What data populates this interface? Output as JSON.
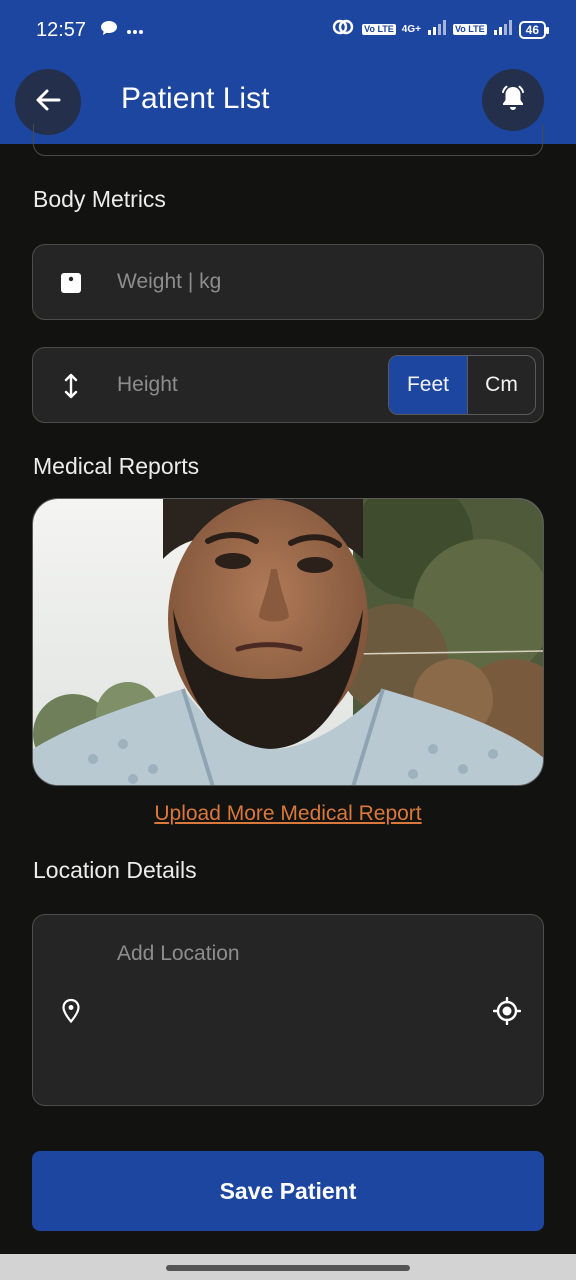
{
  "status_bar": {
    "time": "12:57",
    "network": "4G+",
    "volte": "Vo LTE",
    "battery": "46",
    "icons": [
      "chat-bubble-icon",
      "more-dots-icon",
      "hotspot-link-icon",
      "volte-icon",
      "signal-icon"
    ]
  },
  "app_bar": {
    "title": "Patient List",
    "back_icon": "arrow-left-icon",
    "notification_icon": "bell-icon"
  },
  "body_metrics": {
    "title": "Body Metrics",
    "weight_placeholder": "Weight | kg",
    "weight_icon": "weighing-scale-icon",
    "height_placeholder": "Height",
    "height_icon": "vertical-arrows-icon",
    "units": [
      {
        "label": "Feet",
        "selected": true
      },
      {
        "label": "Cm",
        "selected": false
      }
    ]
  },
  "medical_reports": {
    "title": "Medical Reports",
    "upload_link": "Upload More Medical Report"
  },
  "location": {
    "title": "Location Details",
    "placeholder": "Add Location",
    "pin_icon": "location-pin-icon",
    "gps_icon": "crosshair-gps-icon"
  },
  "save_button": "Save Patient",
  "colors": {
    "primary": "#1d46a0",
    "background": "#121210",
    "field_bg": "#252525",
    "link": "#d8783a"
  }
}
